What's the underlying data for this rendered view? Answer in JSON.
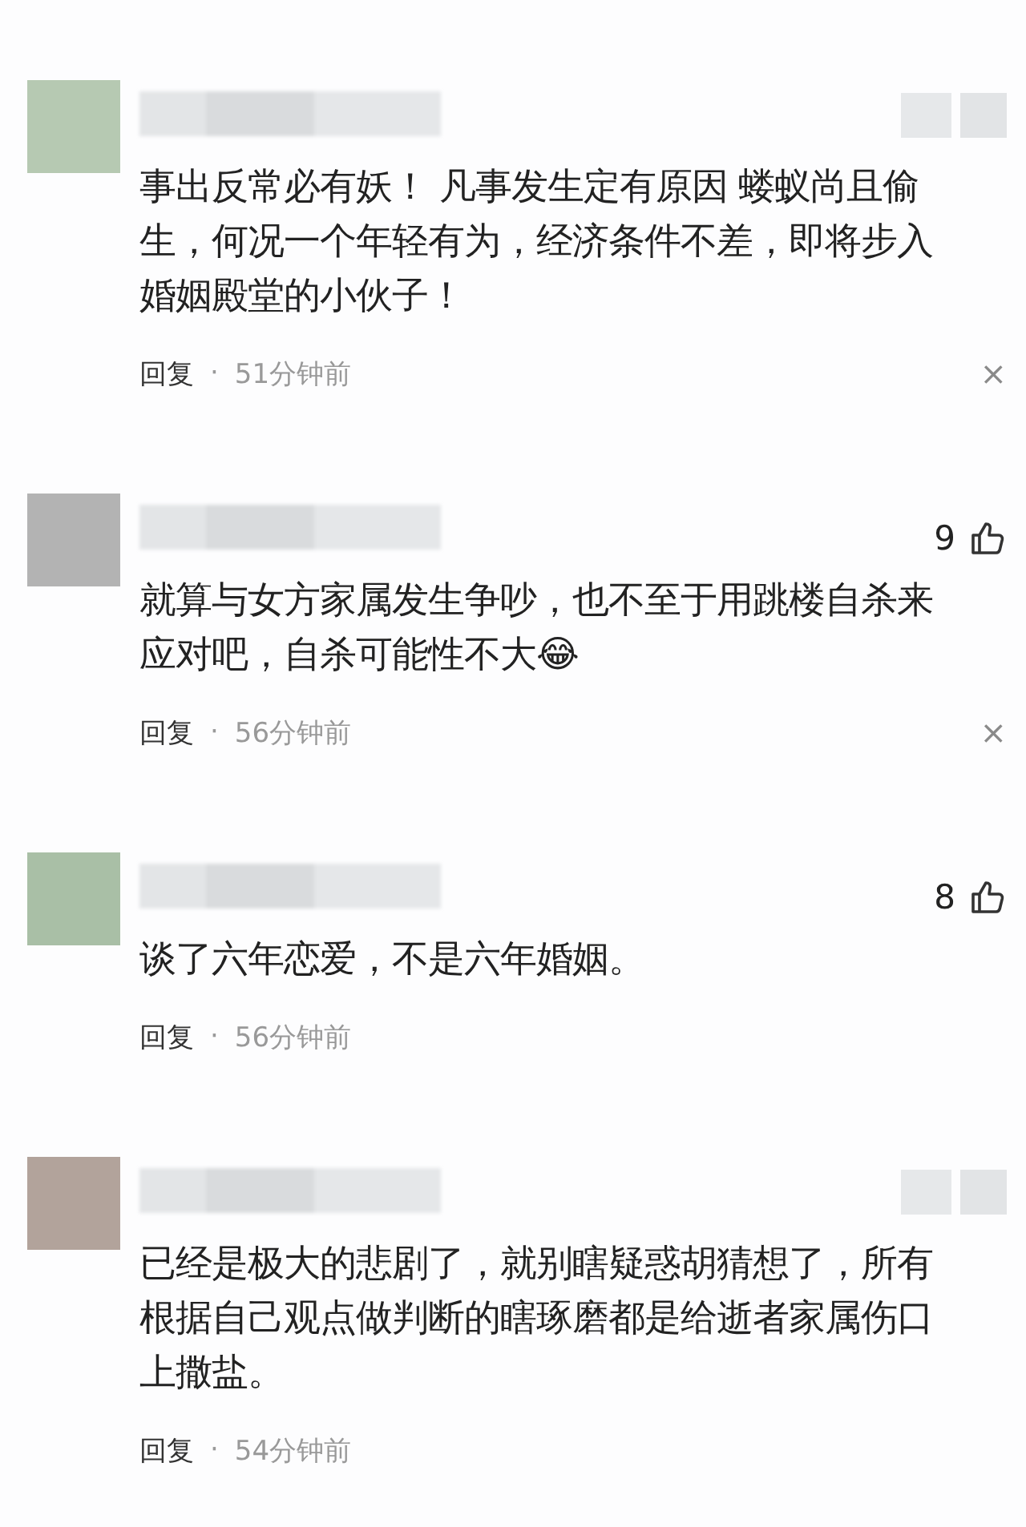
{
  "comments": [
    {
      "color": "#b6c9b2",
      "text": "事出反常必有妖！ 凡事发生定有原因 蝼蚁尚且偷生，何况一个年轻有为，经济条件不差，即将步入婚姻殿堂的小伙子！",
      "reply": "回复",
      "separator": "·",
      "time": "51分钟前",
      "close": "×"
    },
    {
      "color": "#b3b3b3",
      "likes": "9",
      "text": "就算与女方家属发生争吵，也不至于用跳楼自杀来应对吧，自杀可能性不大😂",
      "reply": "回复",
      "separator": "·",
      "time": "56分钟前",
      "close": "×"
    },
    {
      "color": "#a9bfa6",
      "likes": "8",
      "text": "谈了六年恋爱，不是六年婚姻。",
      "reply": "回复",
      "separator": "·",
      "time": "56分钟前"
    },
    {
      "color": "#b2a39b",
      "text": "已经是极大的悲剧了，就别瞎疑惑胡猜想了，所有根据自己观点做判断的瞎琢磨都是给逝者家属伤口上撒盐。",
      "reply": "回复",
      "separator": "·",
      "time": "54分钟前"
    }
  ]
}
